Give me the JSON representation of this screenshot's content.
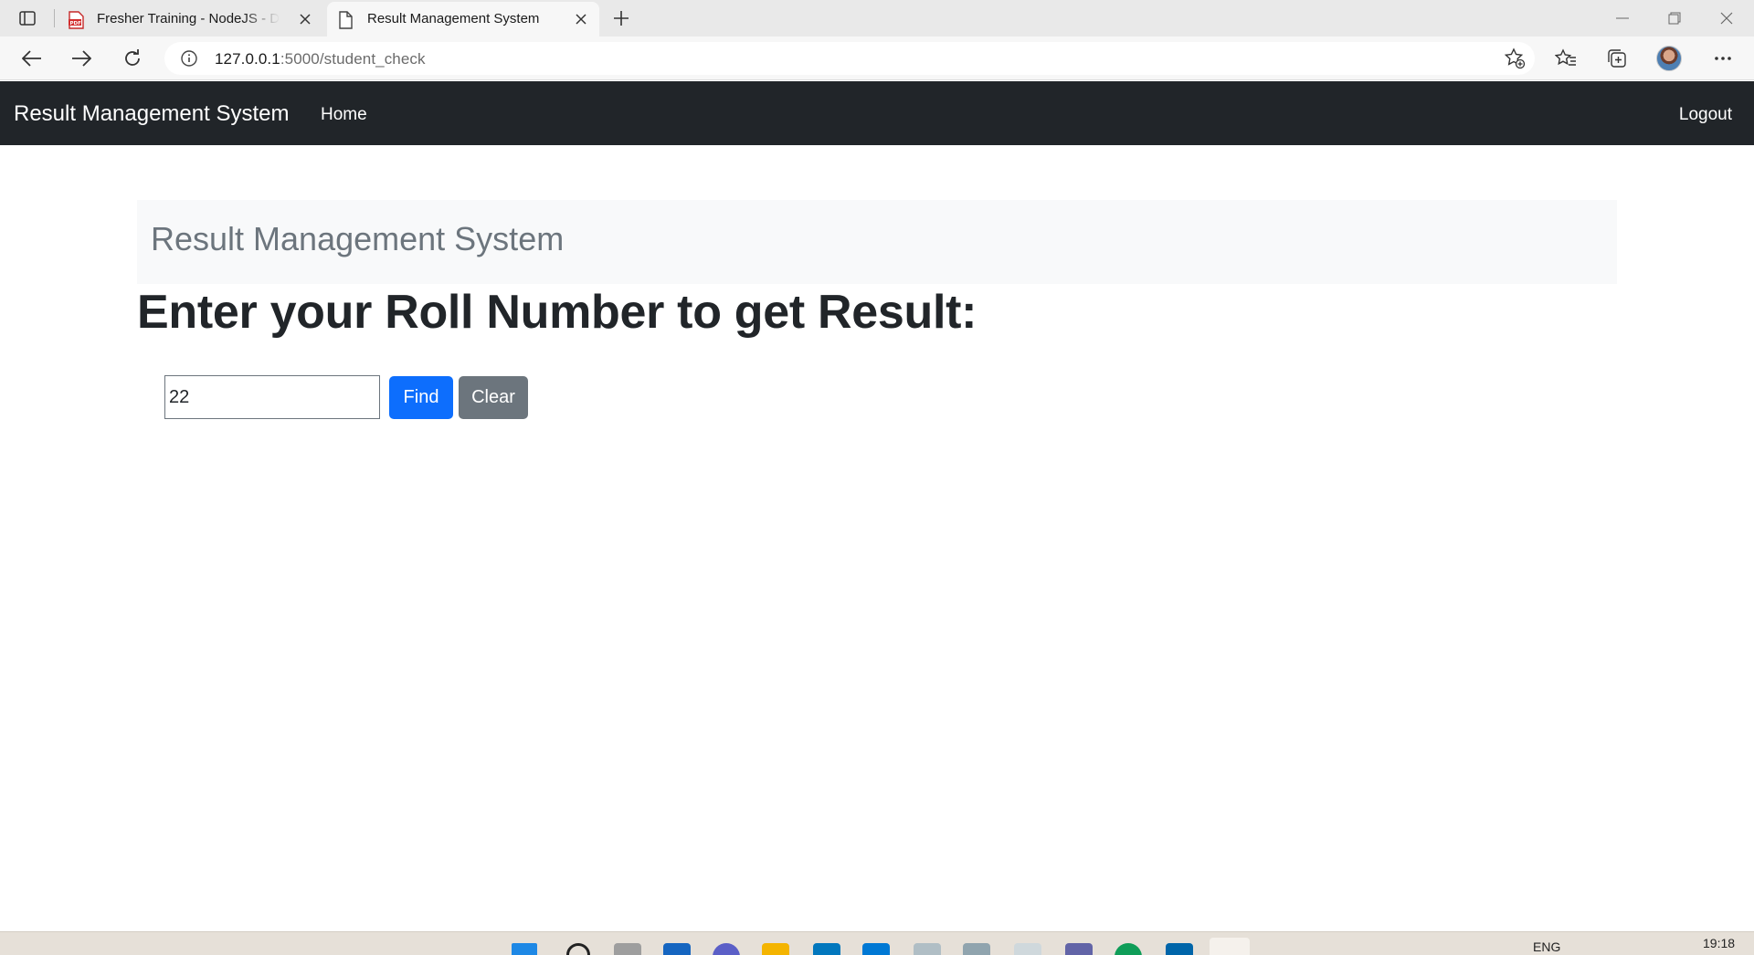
{
  "browser": {
    "tabs": [
      {
        "title": "Fresher Training - NodeJS - Dotr",
        "icon": "pdf-icon",
        "active": false
      },
      {
        "title": "Result Management System",
        "icon": "page-icon",
        "active": true
      }
    ],
    "url_host": "127.0.0.1",
    "url_path": ":5000/student_check"
  },
  "navbar": {
    "brand": "Result Management System",
    "home_label": "Home",
    "logout_label": "Logout"
  },
  "main": {
    "jumbotron_title": "Result Management System",
    "heading": "Enter your Roll Number to get Result:",
    "roll_input_value": "22",
    "find_label": "Find",
    "clear_label": "Clear"
  },
  "taskbar": {
    "language": "ENG",
    "time": "19:18"
  },
  "colors": {
    "navbar_bg": "#212529",
    "primary": "#0d6efd",
    "secondary": "#6c757d",
    "jumbotron_bg": "#f8f9fa"
  }
}
